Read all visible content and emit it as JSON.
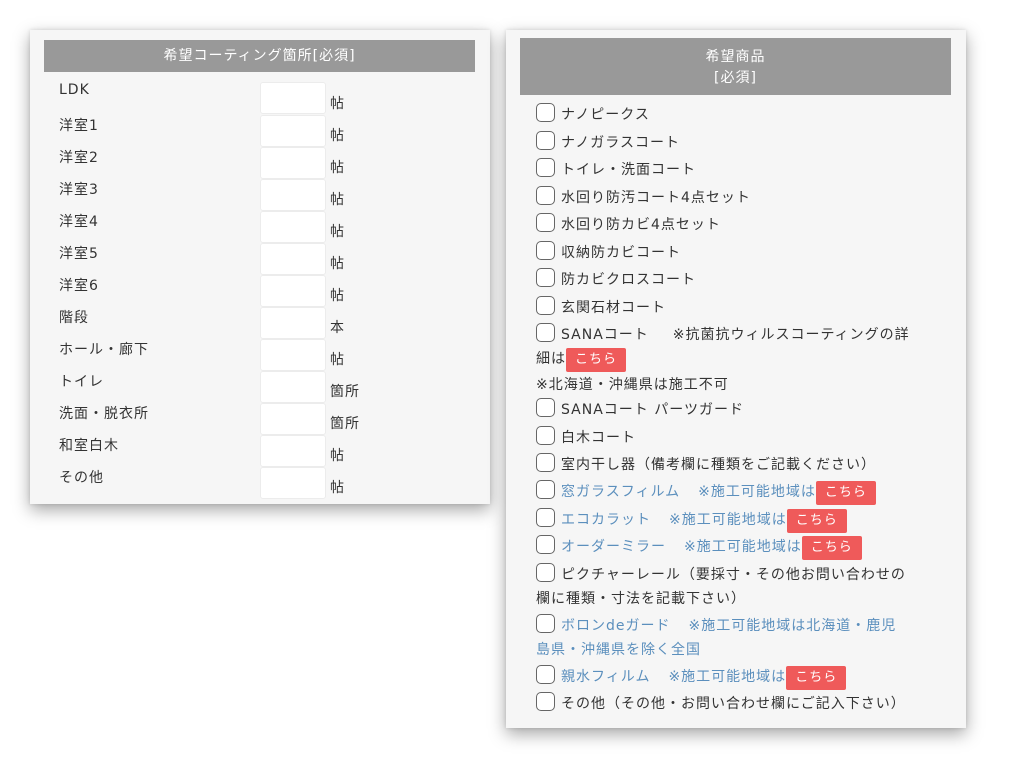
{
  "left_panel": {
    "title": "希望コーティング箇所[必須]",
    "rooms": [
      {
        "label": "LDK",
        "unit": "帖"
      },
      {
        "label": "洋室1",
        "unit": "帖"
      },
      {
        "label": "洋室2",
        "unit": "帖"
      },
      {
        "label": "洋室3",
        "unit": "帖"
      },
      {
        "label": "洋室4",
        "unit": "帖"
      },
      {
        "label": "洋室5",
        "unit": "帖"
      },
      {
        "label": "洋室6",
        "unit": "帖"
      },
      {
        "label": "階段",
        "unit": "本"
      },
      {
        "label": "ホール・廊下",
        "unit": "帖"
      },
      {
        "label": "トイレ",
        "unit": "箇所"
      },
      {
        "label": "洗面・脱衣所",
        "unit": "箇所"
      },
      {
        "label": "和室白木",
        "unit": "帖"
      },
      {
        "label": "その他",
        "unit": "帖"
      }
    ]
  },
  "right_panel": {
    "title": "希望商品",
    "required": "[必須]",
    "link_label": "こちら",
    "items": {
      "nano_peak": "ナノピークス",
      "nano_glass": "ナノガラスコート",
      "toilet_wash": "トイレ・洗面コート",
      "water_4set": "水回り防汚コート4点セット",
      "mold_4set": "水回り防カビ4点セット",
      "storage_mold": "収納防カビコート",
      "cross_mold": "防カビクロスコート",
      "entrance_stone": "玄関石材コート",
      "sana": "SANAコート",
      "sana_note": "※抗菌抗ウィルスコーティングの詳",
      "sana_note_2": "細は",
      "sana_region": "※北海道・沖縄県は施工不可",
      "sana_parts": "SANAコート パーツガード",
      "white_wood": "白木コート",
      "indoor_dryer": "室内干し器（備考欄に種類をご記載ください）",
      "window_film": "窓ガラスフィルム",
      "window_film_note": "※施工可能地域は",
      "eco_carat": "エコカラット",
      "eco_carat_note": "※施工可能地域は",
      "order_mirror": "オーダーミラー",
      "order_mirror_note": "※施工可能地域は",
      "picture_rail": "ピクチャーレール（要採寸・その他お問い合わせの",
      "picture_rail_2": "欄に種類・寸法を記載下さい）",
      "boron": "ボロンdeガード",
      "boron_note": "※施工可能地域は北海道・鹿児",
      "boron_note_2": "島県・沖縄県を除く全国",
      "hydro_film": "親水フィルム",
      "hydro_film_note": "※施工可能地域は",
      "other": "その他（その他・お問い合わせ欄にご記入下さい）"
    }
  },
  "colors": {
    "header": "#999999",
    "panel": "#f6f6f6",
    "link_text": "#5b8fbd",
    "button": "#ef5a5a"
  }
}
